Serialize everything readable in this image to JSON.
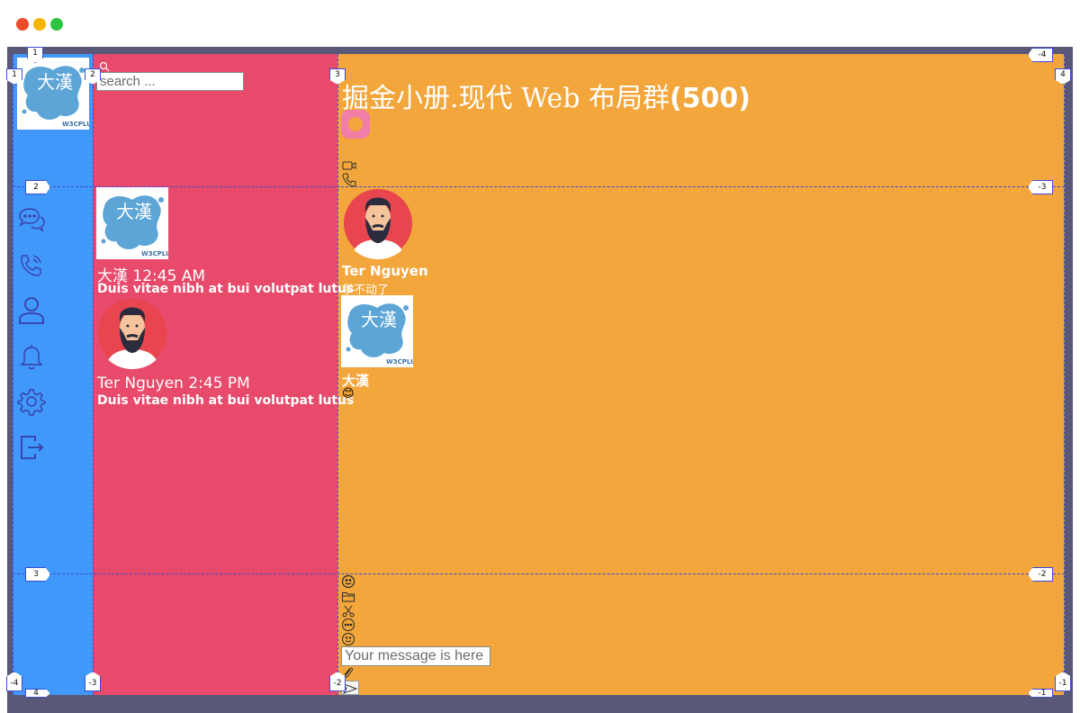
{
  "window": {
    "controls": [
      "close",
      "minimize",
      "maximize"
    ]
  },
  "grid": {
    "col_labels_top": [
      "1",
      "2",
      "3",
      "4"
    ],
    "col_labels_bottom": [
      "-4",
      "-3",
      "-2",
      "-1"
    ],
    "row_labels_left": [
      "1",
      "2",
      "3",
      "4"
    ],
    "row_labels_right": [
      "-4",
      "-3",
      "-2",
      "-1"
    ]
  },
  "nav": {
    "logo": {
      "text": "大漢",
      "brand": "W3CPLUS"
    },
    "icons": [
      "chat-bubbles-icon",
      "phone-call-icon",
      "user-icon",
      "bell-icon",
      "gear-icon",
      "logout-icon"
    ]
  },
  "list": {
    "search": {
      "placeholder": "search ..."
    },
    "conversations": [
      {
        "name": "大漢",
        "time": "12:45 AM",
        "preview": "Duis vitae nibh at bui volutpat lutus"
      },
      {
        "name": "Ter Nguyen",
        "time": "2:45 PM",
        "preview": "Duis vitae nibh at bui volutpat lutus"
      }
    ]
  },
  "chat": {
    "title": "掘金小册.现代 Web 布局群",
    "count": "(500)",
    "header_icons": [
      "video-camera-icon",
      "phone-icon"
    ],
    "messages": [
      {
        "sender": "Ter Nguyen",
        "text": "学不动了"
      },
      {
        "sender": "大漢",
        "text": "😊"
      }
    ],
    "toolbar": [
      "smiley-icon",
      "folder-icon",
      "scissors-icon",
      "more-dots-icon",
      "smiley-alt-icon"
    ],
    "input": {
      "placeholder": "Your message is here ..."
    },
    "send_icon": "send-icon",
    "attach_icon": "paperclip-icon"
  },
  "colors": {
    "nav_bg": "#3f98fa",
    "list_bg": "#e84a6b",
    "chat_bg": "#f2a63b",
    "frame": "#5a5878",
    "grid_line": "#3b4bd6",
    "icon": "#3a3ea8"
  }
}
